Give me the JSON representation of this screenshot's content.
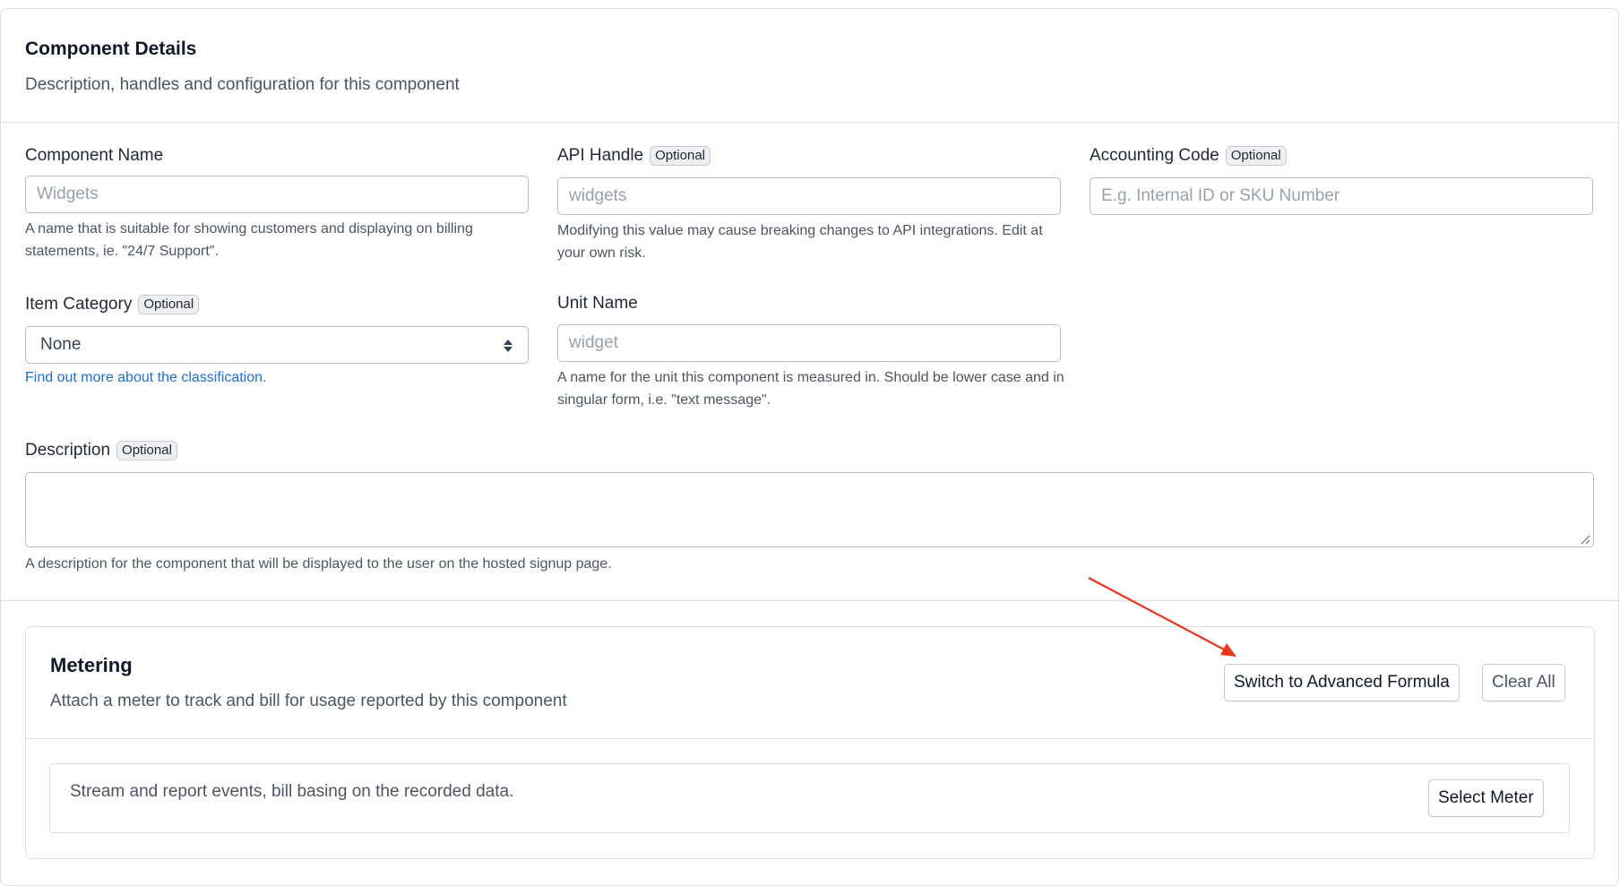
{
  "header": {
    "title": "Component Details",
    "subtitle": "Description, handles and configuration for this component"
  },
  "fields": {
    "component_name": {
      "label": "Component Name",
      "placeholder": "Widgets",
      "help": "A name that is suitable for showing customers and displaying on billing statements, ie. \"24/7 Support\"."
    },
    "api_handle": {
      "label": "API Handle",
      "badge": "Optional",
      "placeholder": "widgets",
      "help": "Modifying this value may cause breaking changes to API integrations. Edit at your own risk."
    },
    "accounting_code": {
      "label": "Accounting Code",
      "badge": "Optional",
      "placeholder": "E.g. Internal ID or SKU Number"
    },
    "item_category": {
      "label": "Item Category",
      "badge": "Optional",
      "value": "None",
      "link": "Find out more about the classification."
    },
    "unit_name": {
      "label": "Unit Name",
      "placeholder": "widget",
      "help": "A name for the unit this component is measured in. Should be lower case and in singular form, i.e. \"text message\"."
    },
    "description": {
      "label": "Description",
      "badge": "Optional",
      "help": "A description for the component that will be displayed to the user on the hosted signup page."
    }
  },
  "metering": {
    "title": "Metering",
    "subtitle": "Attach a meter to track and bill for usage reported by this component",
    "advanced_button": "Switch to Advanced Formula",
    "clear_button": "Clear All",
    "stream_text": "Stream and report events, bill basing on the recorded data.",
    "select_button": "Select Meter"
  },
  "colors": {
    "link": "#1d6fd1",
    "annotation_arrow": "#e8361c",
    "border": "#dcdfe4"
  },
  "icons": {
    "select_arrows": "select-arrows-icon",
    "resize_grip": "resize-grip-icon"
  }
}
